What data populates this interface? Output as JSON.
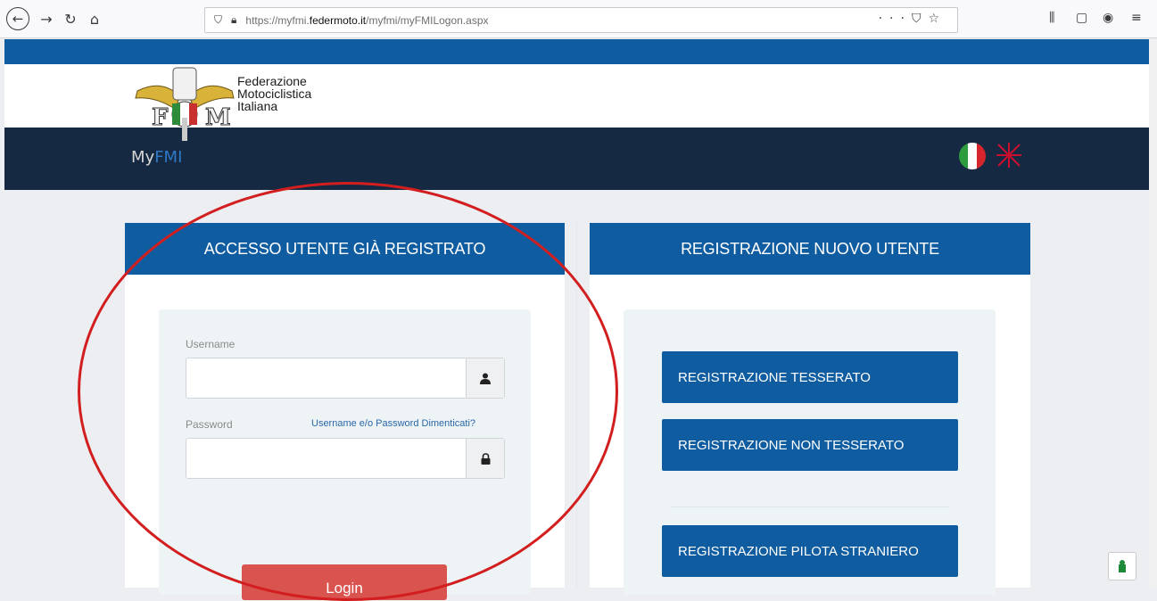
{
  "browser": {
    "url_prefix": "https://myfmi.",
    "url_domain": "federmoto.it",
    "url_path": "/myfmi/myFMILogon.aspx",
    "back_icon": "back-arrow-icon",
    "forward_icon": "forward-arrow-icon",
    "reload_icon": "reload-icon",
    "home_icon": "home-icon"
  },
  "header": {
    "org_line1": "Federazione",
    "org_line2": "Motociclistica",
    "org_line3": "Italiana",
    "app_name_prefix": "My",
    "app_name_suffix": "FMI",
    "accent_color": "#0f5ca0",
    "navy_color": "#152a42"
  },
  "login_panel": {
    "title": "ACCESSO UTENTE GIÀ REGISTRATO",
    "username_label": "Username",
    "username_value": "",
    "password_label": "Password",
    "password_value": "",
    "forgot_link": "Username e/o Password Dimenticati?",
    "login_button": "Login",
    "login_color": "#d9534f"
  },
  "register_panel": {
    "title": "REGISTRAZIONE NUOVO UTENTE",
    "buttons": [
      "REGISTRAZIONE TESSERATO",
      "REGISTRAZIONE NON TESSERATO",
      "REGISTRAZIONE PILOTA STRANIERO"
    ]
  },
  "annotation": {
    "circle_color": "#d21e1e"
  }
}
